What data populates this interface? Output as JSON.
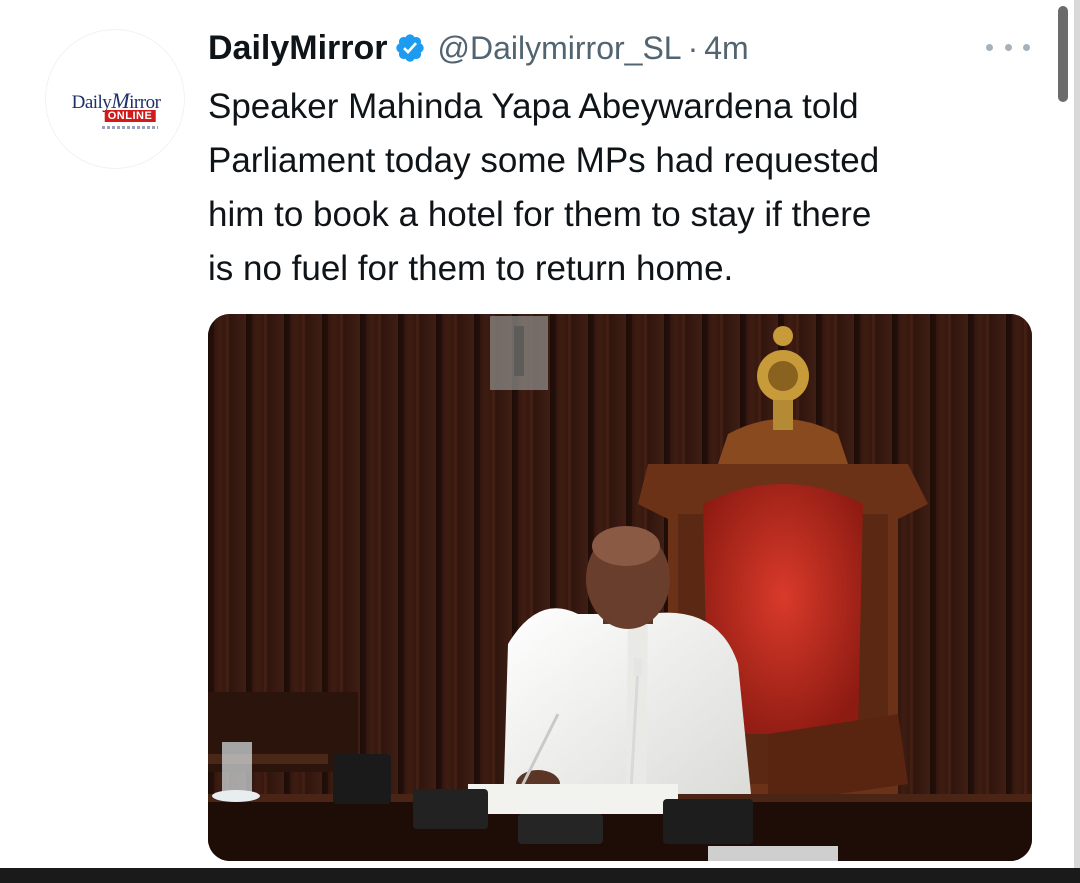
{
  "tweet": {
    "avatar": {
      "logo_text_daily": "Daily",
      "logo_text_m": "M",
      "logo_text_irror": "irror",
      "logo_badge": "ONLINE"
    },
    "display_name": "DailyMirror",
    "verified_icon": "verified-badge-icon",
    "handle": "@Dailymirror_SL",
    "separator": "·",
    "timestamp": "4m",
    "more_icon": "more-options-icon",
    "text": "Speaker Mahinda Yapa Abeywardena told\nParliament today some MPs had requested\nhim to book a hotel for them to stay if there\nis no fuel for them to return home.",
    "media": {
      "type": "photo",
      "icon": "photo"
    }
  },
  "colors": {
    "verified": "#1d9bf0",
    "secondary_text": "#536471",
    "primary_text": "#0f1419"
  }
}
